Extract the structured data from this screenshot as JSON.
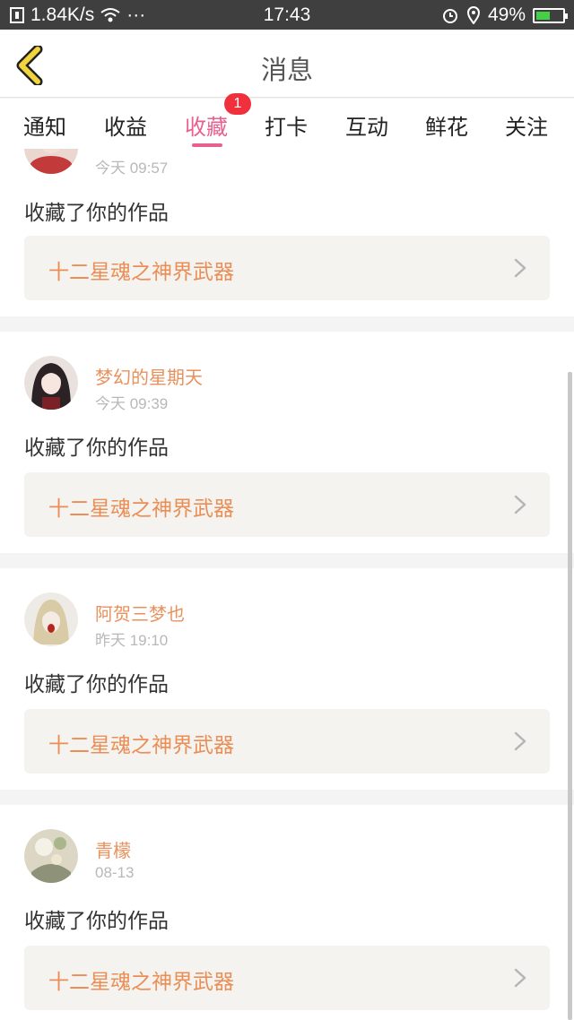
{
  "status_bar": {
    "network_speed": "1.84K/s",
    "more": "···",
    "time": "17:43",
    "battery": "49%",
    "battery_level": 0.49
  },
  "header": {
    "title": "消息"
  },
  "tabs": [
    {
      "label": "通知"
    },
    {
      "label": "收益"
    },
    {
      "label": "收藏",
      "active": true,
      "badge": "1"
    },
    {
      "label": "打卡"
    },
    {
      "label": "互动"
    },
    {
      "label": "鲜花"
    },
    {
      "label": "关注"
    }
  ],
  "feed": [
    {
      "username": "",
      "time": "今天 09:57",
      "action": "收藏了你的作品",
      "work_title": "十二星魂之神界武器"
    },
    {
      "username": "梦幻的星期天",
      "time": "今天 09:39",
      "action": "收藏了你的作品",
      "work_title": "十二星魂之神界武器"
    },
    {
      "username": "阿贺三梦也",
      "time": "昨天 19:10",
      "action": "收藏了你的作品",
      "work_title": "十二星魂之神界武器"
    },
    {
      "username": "青檬",
      "time": "08-13",
      "action": "收藏了你的作品",
      "work_title": "十二星魂之神界武器"
    }
  ],
  "colors": {
    "accent": "#e8618c",
    "username": "#e8915c",
    "work_title": "#ea8e56",
    "badge": "#f0303c",
    "back_arrow": "#f2d43c"
  }
}
